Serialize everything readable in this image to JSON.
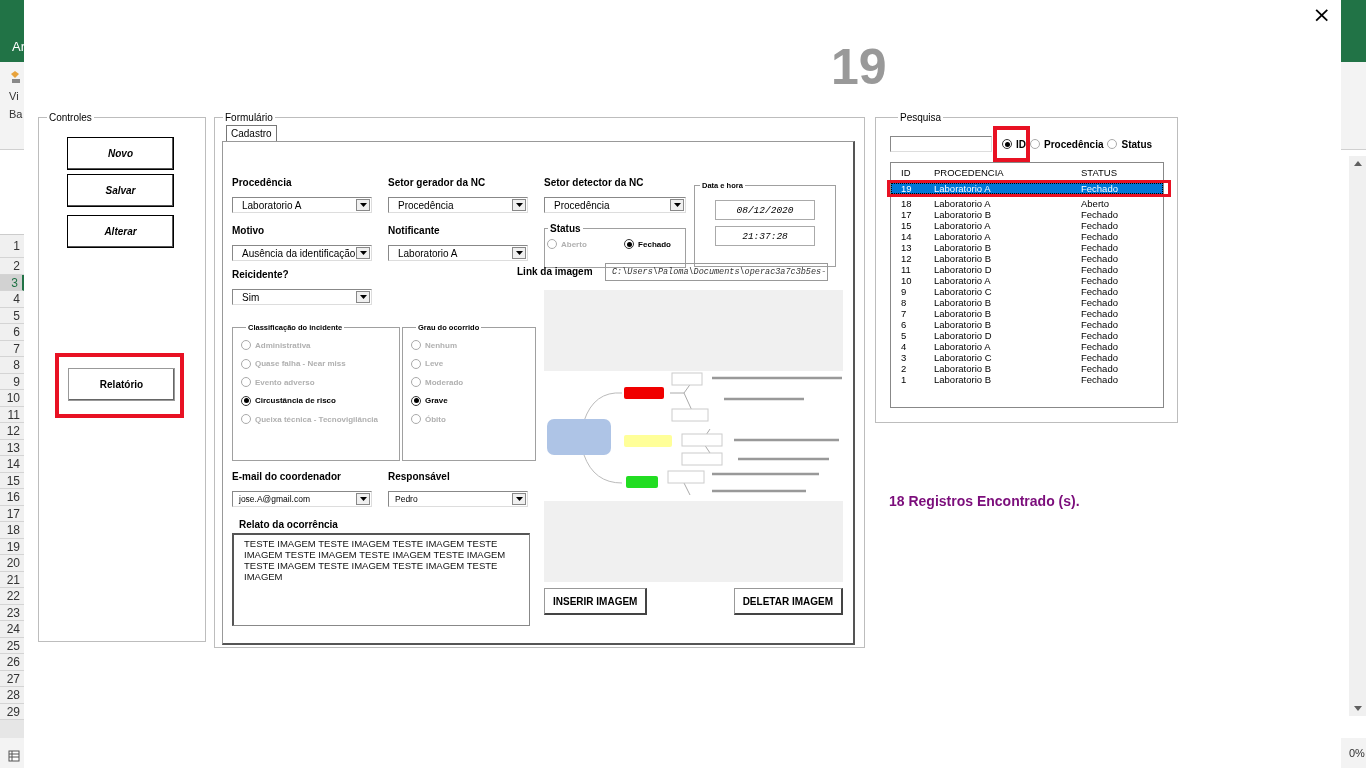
{
  "excel": {
    "ribbon_fragments": [
      "Ar",
      "Vi",
      "Ba"
    ],
    "zoom_fragment": "0%",
    "row_numbers": [
      {
        "label": "1",
        "selected": false
      },
      {
        "label": "2",
        "selected": false
      },
      {
        "label": "3",
        "selected": true
      },
      {
        "label": "4",
        "selected": false
      },
      {
        "label": "5",
        "selected": false
      },
      {
        "label": "6",
        "selected": false
      },
      {
        "label": "7",
        "selected": false
      },
      {
        "label": "8",
        "selected": false
      },
      {
        "label": "9",
        "selected": false
      },
      {
        "label": "10",
        "selected": false
      },
      {
        "label": "11",
        "selected": false
      },
      {
        "label": "12",
        "selected": false
      },
      {
        "label": "13",
        "selected": false
      },
      {
        "label": "14",
        "selected": false
      },
      {
        "label": "15",
        "selected": false
      },
      {
        "label": "16",
        "selected": false
      },
      {
        "label": "17",
        "selected": false
      },
      {
        "label": "18",
        "selected": false
      },
      {
        "label": "19",
        "selected": false
      },
      {
        "label": "20",
        "selected": false
      },
      {
        "label": "21",
        "selected": false
      },
      {
        "label": "22",
        "selected": false
      },
      {
        "label": "23",
        "selected": false
      },
      {
        "label": "24",
        "selected": false
      },
      {
        "label": "25",
        "selected": false
      },
      {
        "label": "26",
        "selected": false
      },
      {
        "label": "27",
        "selected": false
      },
      {
        "label": "28",
        "selected": false
      },
      {
        "label": "29",
        "selected": false
      }
    ]
  },
  "dialog": {
    "close": "×",
    "record_id": "19"
  },
  "controls": {
    "legend": "Controles",
    "buttons": [
      {
        "label": "Novo"
      },
      {
        "label": "Salvar"
      },
      {
        "label": "Alterar"
      }
    ],
    "report_button": {
      "label": "Relatório",
      "highlighted": true
    }
  },
  "form": {
    "legend": "Formulário",
    "tabs": [
      {
        "label": "Cadastro",
        "selected": true
      }
    ],
    "dropdowns": [
      {
        "label": "Procedência",
        "value": "Laboratorio A"
      },
      {
        "label": "Setor gerador da NC",
        "value": "Procedência"
      },
      {
        "label": "Motivo",
        "value": "Ausência da identificação"
      },
      {
        "label": "Notificante",
        "value": "Laboratorio A"
      },
      {
        "label": "Reicidente?",
        "value": "Sim"
      },
      {
        "label": "E-mail do coordenador",
        "value": "jose.A@gmail.com"
      },
      {
        "label": "Responsável",
        "value": "Pedro"
      },
      {
        "label": "Setor detector da NC",
        "value": "Procedência"
      }
    ],
    "status": {
      "legend": "Status",
      "options": [
        {
          "label": "Aberto",
          "selected": false
        },
        {
          "label": "Fechado",
          "selected": true
        }
      ]
    },
    "date_time": {
      "legend": "Data e hora",
      "date": "08/12/2020",
      "time": "21:37:28"
    },
    "classification": {
      "legend": "Classificação do incidente",
      "options": [
        {
          "label": "Administrativa",
          "selected": false
        },
        {
          "label": "Quase falha - Near miss",
          "selected": false
        },
        {
          "label": "Evento adverso",
          "selected": false
        },
        {
          "label": "Circustância de risco",
          "selected": true
        },
        {
          "label": "Queixa técnica - Tecnovigilância",
          "selected": false
        }
      ]
    },
    "severity": {
      "legend": "Grau do ocorrido",
      "options": [
        {
          "label": "Nenhum",
          "selected": false
        },
        {
          "label": "Leve",
          "selected": false
        },
        {
          "label": "Moderado",
          "selected": false
        },
        {
          "label": "Grave",
          "selected": true
        },
        {
          "label": "Óbito",
          "selected": false
        }
      ]
    },
    "report": {
      "label": "Relato da ocorrência",
      "value": "TESTE IMAGEM TESTE IMAGEM TESTE IMAGEM TESTE IMAGEM TESTE IMAGEM TESTE IMAGEM TESTE IMAGEM TESTE IMAGEM TESTE IMAGEM TESTE IMAGEM TESTE IMAGEM"
    },
    "image_link": {
      "label": "Link da imagem",
      "value": "C:\\Users\\Paloma\\Documents\\operac3a7c3b5es-"
    },
    "image": {
      "kind": "picture"
    },
    "image_buttons": [
      "INSERIR IMAGEM",
      "DELETAR IMAGEM"
    ]
  },
  "search": {
    "legend": "Pesquisa",
    "options": [
      {
        "label": "ID",
        "selected": true,
        "highlighted": true
      },
      {
        "label": "Procedência",
        "selected": false,
        "highlighted": false
      },
      {
        "label": "Status",
        "selected": false,
        "highlighted": false
      }
    ],
    "columns": [
      "ID",
      "PROCEDENCIA",
      "STATUS"
    ],
    "rows": [
      {
        "id": "19",
        "origin": "Laboratorio A",
        "status": "Fechado",
        "selected": true,
        "highlighted": true
      },
      {
        "id": "18",
        "origin": "Laboratorio A",
        "status": "Aberto",
        "selected": false,
        "highlighted": false
      },
      {
        "id": "17",
        "origin": "Laboratorio B",
        "status": "Fechado",
        "selected": false,
        "highlighted": false
      },
      {
        "id": "15",
        "origin": "Laboratorio A",
        "status": "Fechado",
        "selected": false,
        "highlighted": false
      },
      {
        "id": "14",
        "origin": "Laboratorio A",
        "status": "Fechado",
        "selected": false,
        "highlighted": false
      },
      {
        "id": "13",
        "origin": "Laboratorio B",
        "status": "Fechado",
        "selected": false,
        "highlighted": false
      },
      {
        "id": "12",
        "origin": "Laboratorio B",
        "status": "Fechado",
        "selected": false,
        "highlighted": false
      },
      {
        "id": "11",
        "origin": "Laboratorio D",
        "status": "Fechado",
        "selected": false,
        "highlighted": false
      },
      {
        "id": "10",
        "origin": "Laboratorio A",
        "status": "Fechado",
        "selected": false,
        "highlighted": false
      },
      {
        "id": "9",
        "origin": "Laboratorio C",
        "status": "Fechado",
        "selected": false,
        "highlighted": false
      },
      {
        "id": "8",
        "origin": "Laboratorio B",
        "status": "Fechado",
        "selected": false,
        "highlighted": false
      },
      {
        "id": "7",
        "origin": "Laboratorio B",
        "status": "Fechado",
        "selected": false,
        "highlighted": false
      },
      {
        "id": "6",
        "origin": "Laboratorio B",
        "status": "Fechado",
        "selected": false,
        "highlighted": false
      },
      {
        "id": "5",
        "origin": "Laboratorio D",
        "status": "Fechado",
        "selected": false,
        "highlighted": false
      },
      {
        "id": "4",
        "origin": "Laboratorio A",
        "status": "Fechado",
        "selected": false,
        "highlighted": false
      },
      {
        "id": "3",
        "origin": "Laboratorio C",
        "status": "Fechado",
        "selected": false,
        "highlighted": false
      },
      {
        "id": "2",
        "origin": "Laboratorio B",
        "status": "Fechado",
        "selected": false,
        "highlighted": false
      },
      {
        "id": "1",
        "origin": "Laboratorio B",
        "status": "Fechado",
        "selected": false,
        "highlighted": false
      }
    ],
    "result": "18 Registros Encontrado (s)."
  }
}
